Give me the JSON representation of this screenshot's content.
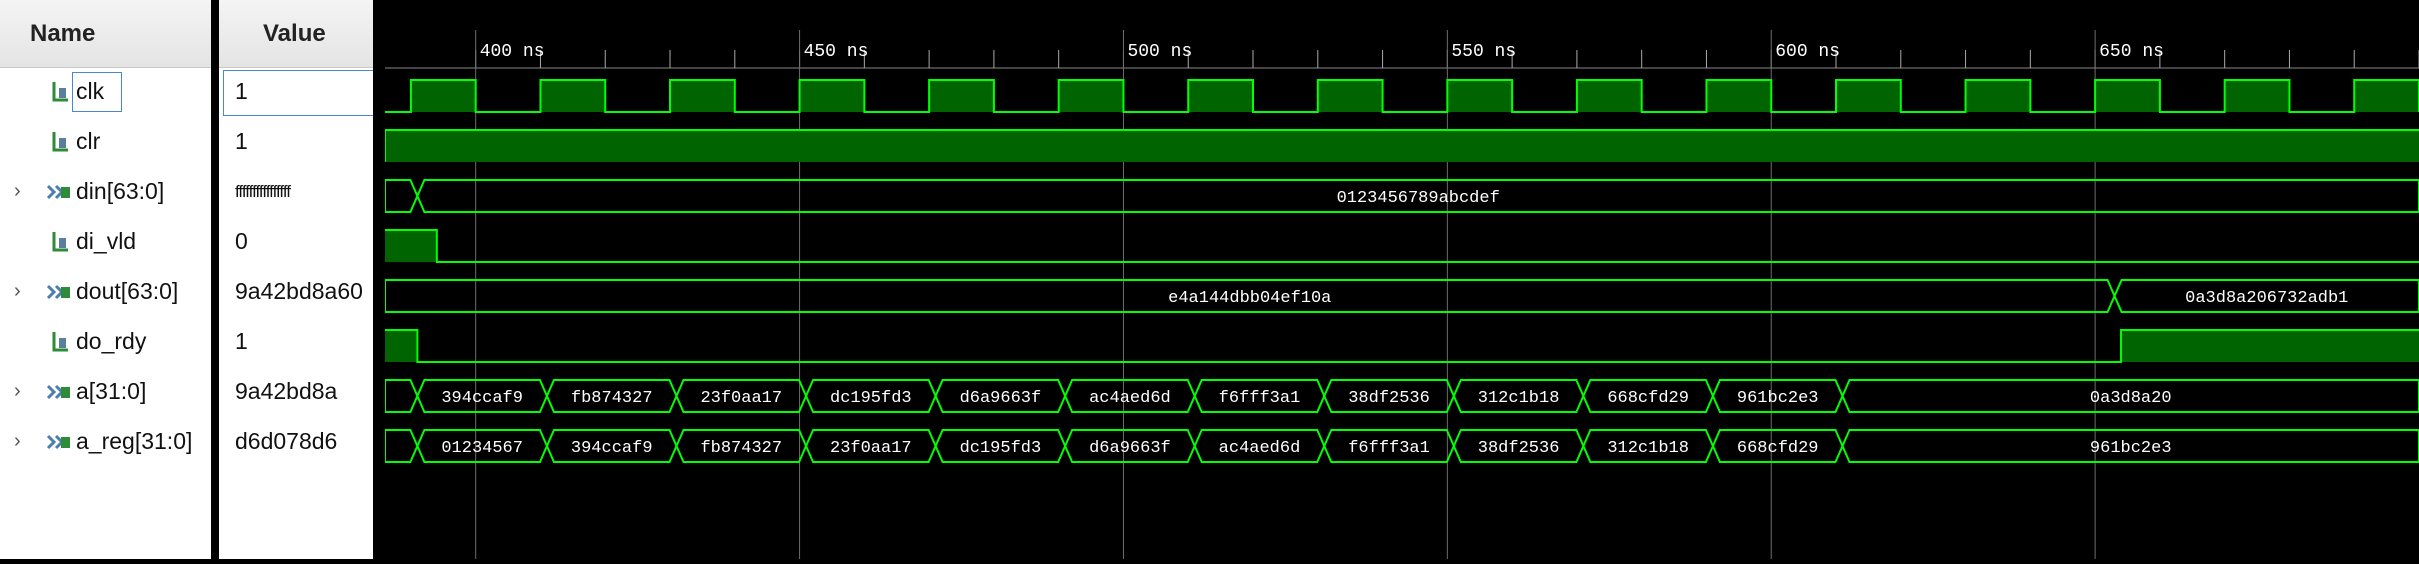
{
  "columns": {
    "name_header": "Name",
    "value_header": "Value"
  },
  "signals": [
    {
      "name": "clk",
      "value": "1",
      "type": "bit",
      "expandable": false
    },
    {
      "name": "clr",
      "value": "1",
      "type": "bit",
      "expandable": false
    },
    {
      "name": "din[63:0]",
      "value": "ffffffffffffffff",
      "type": "bus",
      "expandable": true
    },
    {
      "name": "di_vld",
      "value": "0",
      "type": "bit",
      "expandable": false
    },
    {
      "name": "dout[63:0]",
      "value": "9a42bd8a60",
      "type": "bus",
      "expandable": true
    },
    {
      "name": "do_rdy",
      "value": "1",
      "type": "bit",
      "expandable": false
    },
    {
      "name": "a[31:0]",
      "value": "9a42bd8a",
      "type": "bus",
      "expandable": true
    },
    {
      "name": "a_reg[31:0]",
      "value": "d6d078d6",
      "type": "bus",
      "expandable": true
    }
  ],
  "timeline": {
    "unit": "ns",
    "labels": [
      "400 ns",
      "450 ns",
      "500 ns",
      "550 ns",
      "600 ns",
      "650 ns"
    ],
    "range_ns": [
      386,
      700
    ]
  },
  "waves": {
    "clk": {
      "period_ns": 20,
      "first_rise_ns": 390
    },
    "clr": {
      "high_from_ns": 386
    },
    "di_vld": {
      "high_until_ns": 394
    },
    "do_rdy": {
      "high_until_ns": 391,
      "high_from_ns": 654
    },
    "din": {
      "segments": [
        {
          "t0": 386,
          "t1": 391,
          "text": ""
        },
        {
          "t0": 391,
          "t1": 700,
          "text": "0123456789abcdef"
        }
      ]
    },
    "dout": {
      "segments": [
        {
          "t0": 386,
          "t1": 653,
          "text": "e4a144dbb04ef10a"
        },
        {
          "t0": 653,
          "t1": 700,
          "text": "0a3d8a206732adb1"
        }
      ]
    },
    "a": {
      "segments": [
        {
          "t0": 386,
          "t1": 391,
          "text": ""
        },
        {
          "t0": 391,
          "t1": 411,
          "text": "394ccaf9"
        },
        {
          "t0": 411,
          "t1": 431,
          "text": "fb874327"
        },
        {
          "t0": 431,
          "t1": 451,
          "text": "23f0aa17"
        },
        {
          "t0": 451,
          "t1": 471,
          "text": "dc195fd3"
        },
        {
          "t0": 471,
          "t1": 491,
          "text": "d6a9663f"
        },
        {
          "t0": 491,
          "t1": 511,
          "text": "ac4aed6d"
        },
        {
          "t0": 511,
          "t1": 531,
          "text": "f6fff3a1"
        },
        {
          "t0": 531,
          "t1": 551,
          "text": "38df2536"
        },
        {
          "t0": 551,
          "t1": 571,
          "text": "312c1b18"
        },
        {
          "t0": 571,
          "t1": 591,
          "text": "668cfd29"
        },
        {
          "t0": 591,
          "t1": 611,
          "text": "961bc2e3"
        },
        {
          "t0": 611,
          "t1": 700,
          "text": "0a3d8a20"
        }
      ]
    },
    "a_reg": {
      "segments": [
        {
          "t0": 386,
          "t1": 391,
          "text": ""
        },
        {
          "t0": 391,
          "t1": 411,
          "text": "01234567"
        },
        {
          "t0": 411,
          "t1": 431,
          "text": "394ccaf9"
        },
        {
          "t0": 431,
          "t1": 451,
          "text": "fb874327"
        },
        {
          "t0": 451,
          "t1": 471,
          "text": "23f0aa17"
        },
        {
          "t0": 471,
          "t1": 491,
          "text": "dc195fd3"
        },
        {
          "t0": 491,
          "t1": 511,
          "text": "d6a9663f"
        },
        {
          "t0": 511,
          "t1": 531,
          "text": "ac4aed6d"
        },
        {
          "t0": 531,
          "t1": 551,
          "text": "f6fff3a1"
        },
        {
          "t0": 551,
          "t1": 571,
          "text": "38df2536"
        },
        {
          "t0": 571,
          "t1": 591,
          "text": "312c1b18"
        },
        {
          "t0": 591,
          "t1": 611,
          "text": "668cfd29"
        },
        {
          "t0": 611,
          "t1": 700,
          "text": "961bc2e3"
        }
      ]
    }
  },
  "colors": {
    "wave": "#00ff00",
    "wave_fill": "#006400",
    "background": "#000000",
    "grid": "#6e6e6e",
    "bus_text": "#ffffff",
    "selection": "#4a86d6"
  }
}
